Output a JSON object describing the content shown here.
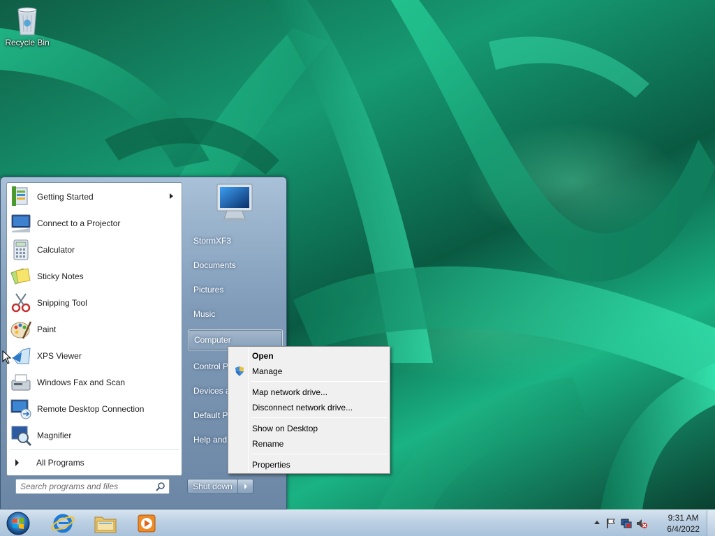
{
  "desktop": {
    "icons": [
      {
        "label": "Recycle Bin",
        "icon": "recycle-bin-icon"
      }
    ]
  },
  "start_menu": {
    "programs": [
      {
        "label": "Getting Started",
        "icon": "getting-started-icon",
        "has_submenu": true
      },
      {
        "label": "Connect to a Projector",
        "icon": "projector-icon"
      },
      {
        "label": "Calculator",
        "icon": "calculator-icon"
      },
      {
        "label": "Sticky Notes",
        "icon": "sticky-notes-icon"
      },
      {
        "label": "Snipping Tool",
        "icon": "snipping-tool-icon"
      },
      {
        "label": "Paint",
        "icon": "paint-icon"
      },
      {
        "label": "XPS Viewer",
        "icon": "xps-viewer-icon"
      },
      {
        "label": "Windows Fax and Scan",
        "icon": "fax-scan-icon"
      },
      {
        "label": "Remote Desktop Connection",
        "icon": "remote-desktop-icon"
      },
      {
        "label": "Magnifier",
        "icon": "magnifier-icon"
      }
    ],
    "all_programs_label": "All Programs",
    "search_placeholder": "Search programs and files",
    "right_items": [
      {
        "label": "StormXF3"
      },
      {
        "label": "Documents"
      },
      {
        "label": "Pictures"
      },
      {
        "label": "Music"
      },
      {
        "label": "Computer",
        "highlighted": true
      },
      {
        "label": "Control P"
      },
      {
        "label": "Devices a"
      },
      {
        "label": "Default P"
      },
      {
        "label": "Help and"
      }
    ],
    "shutdown_label": "Shut down"
  },
  "context_menu": {
    "items": [
      {
        "label": "Open",
        "bold": true
      },
      {
        "label": "Manage",
        "icon": "uac-shield-icon"
      },
      {
        "label": "Map network drive..."
      },
      {
        "label": "Disconnect network drive..."
      },
      {
        "label": "Show on Desktop"
      },
      {
        "label": "Rename"
      },
      {
        "label": "Properties"
      }
    ]
  },
  "taskbar": {
    "pinned": [
      {
        "name": "internet-explorer-icon"
      },
      {
        "name": "windows-explorer-icon"
      },
      {
        "name": "media-player-icon"
      }
    ],
    "tray_icons": [
      "action-center-flag-icon",
      "network-icon",
      "volume-muted-icon"
    ],
    "clock": {
      "time": "9:31 AM",
      "date": "6/4/2022"
    }
  },
  "colors": {
    "start_menu_accent": "#7f9bb8",
    "taskbar": "#bcd0e3",
    "wallpaper": "#169a72"
  }
}
